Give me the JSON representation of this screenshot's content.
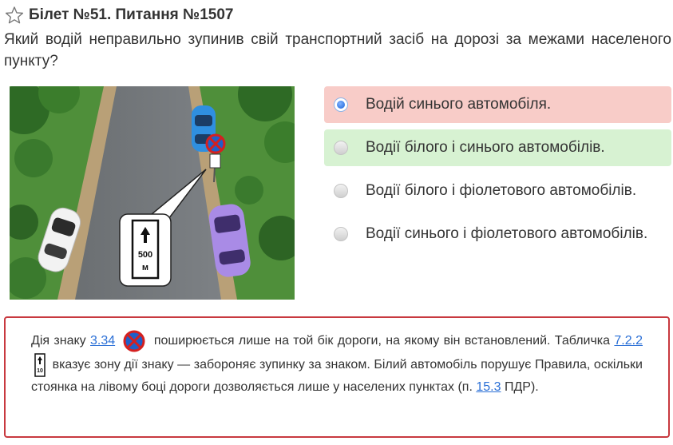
{
  "header": {
    "title": "Білет №51. Питання №1507",
    "favorite_icon": "star-outline-icon"
  },
  "question": {
    "text": "Який водій неправильно зупинив свій транспортний засіб на дорозі за межами населеного пункту?"
  },
  "scene": {
    "plate_distance": "500",
    "plate_unit": "м"
  },
  "answers": [
    {
      "text": "Водій синього автомобіля.",
      "state": "wrong",
      "selected": true
    },
    {
      "text": "Водії білого і синього автомобілів.",
      "state": "correct",
      "selected": false
    },
    {
      "text": "Водії білого і фіолетового автомобілів.",
      "state": "neutral",
      "selected": false
    },
    {
      "text": "Водії синього і фіолетового автомобілів.",
      "state": "neutral",
      "selected": false
    }
  ],
  "explanation": {
    "part1": "Дія знаку",
    "link1": "3.34",
    "part2": "поширюється лише на той бік дороги, на якому він встановлений. Табличка",
    "link2": "7.2.2",
    "part3": "вказує зону дії знаку — забороняє зупинку за знаком. Білий автомобіль порушує Правила, оскільки стоянка на лівому боці дороги дозволяється лише у населених пунктах (п.",
    "link3": "15.3",
    "part4": "ПДР).",
    "mini_plate_num": "10"
  },
  "colors": {
    "wrong_bg": "#f8ccc8",
    "correct_bg": "#d7f2d2",
    "explain_border": "#c8393f",
    "link": "#2a6fd6"
  }
}
